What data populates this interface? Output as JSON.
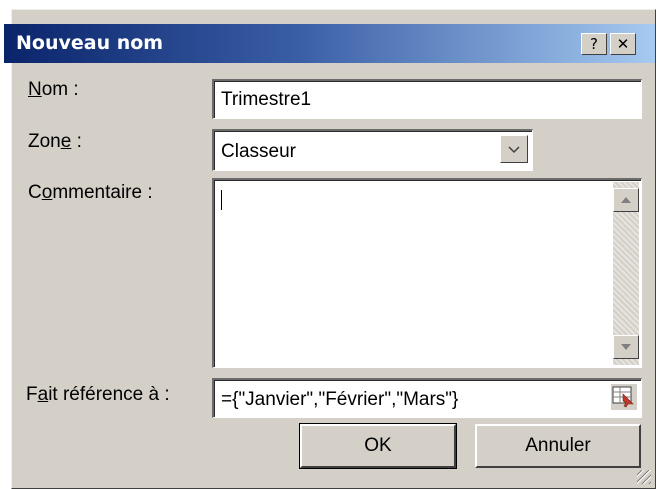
{
  "window": {
    "title": "Nouveau nom",
    "help_glyph": "?",
    "close_glyph": "✕"
  },
  "form": {
    "name_label_mnemonic": "N",
    "name_label_rest": "om :",
    "name_value": "Trimestre1",
    "zone_label_pre": "Zon",
    "zone_label_mnemonic": "e",
    "zone_label_rest": " :",
    "zone_value": "Classeur",
    "comment_label_pre": "C",
    "comment_label_mnemonic": "o",
    "comment_label_rest": "mmentaire :",
    "comment_value": "",
    "ref_label_pre": "F",
    "ref_label_mnemonic": "a",
    "ref_label_rest": "it référence à :",
    "ref_value": "={\"Janvier\",\"Février\",\"Mars\"}"
  },
  "buttons": {
    "ok": "OK",
    "cancel": "Annuler"
  },
  "icons": {
    "dropdown": "chevron-down-icon",
    "scroll_up": "arrow-up-icon",
    "scroll_down": "arrow-down-icon",
    "ref_select": "range-select-icon"
  }
}
